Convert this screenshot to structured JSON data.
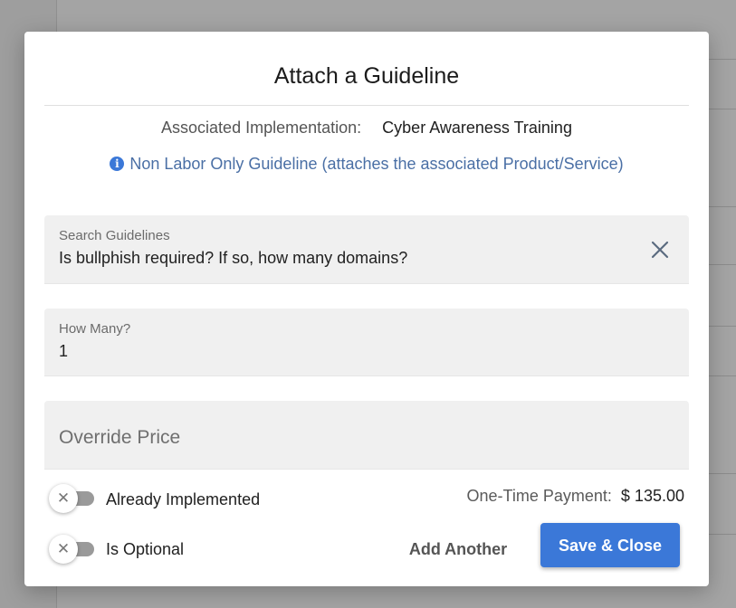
{
  "dialog": {
    "title": "Attach a Guideline",
    "associated_label": "Associated Implementation:",
    "associated_value": "Cyber Awareness Training",
    "info_text": "Non Labor Only Guideline (attaches the associated Product/Service)",
    "info_icon": "info-icon",
    "search": {
      "label": "Search Guidelines",
      "value": "Is bullphish required? If so, how many domains?",
      "clear_icon": "close-icon"
    },
    "quantity": {
      "label": "How Many?",
      "value": "1"
    },
    "override_price": {
      "placeholder": "Override Price"
    },
    "toggles": {
      "already_implemented": {
        "label": "Already Implemented",
        "on": false
      },
      "is_optional": {
        "label": "Is Optional",
        "on": false
      }
    },
    "payment": {
      "label": "One-Time Payment:",
      "value": "$ 135.00"
    },
    "buttons": {
      "add_another": "Add Another",
      "save_close": "Save & Close"
    }
  },
  "colors": {
    "primary": "#3b78d8",
    "info_text": "#4a6fa5",
    "field_bg": "#f0f0f0",
    "toggle_off": "#9a9a9a"
  }
}
